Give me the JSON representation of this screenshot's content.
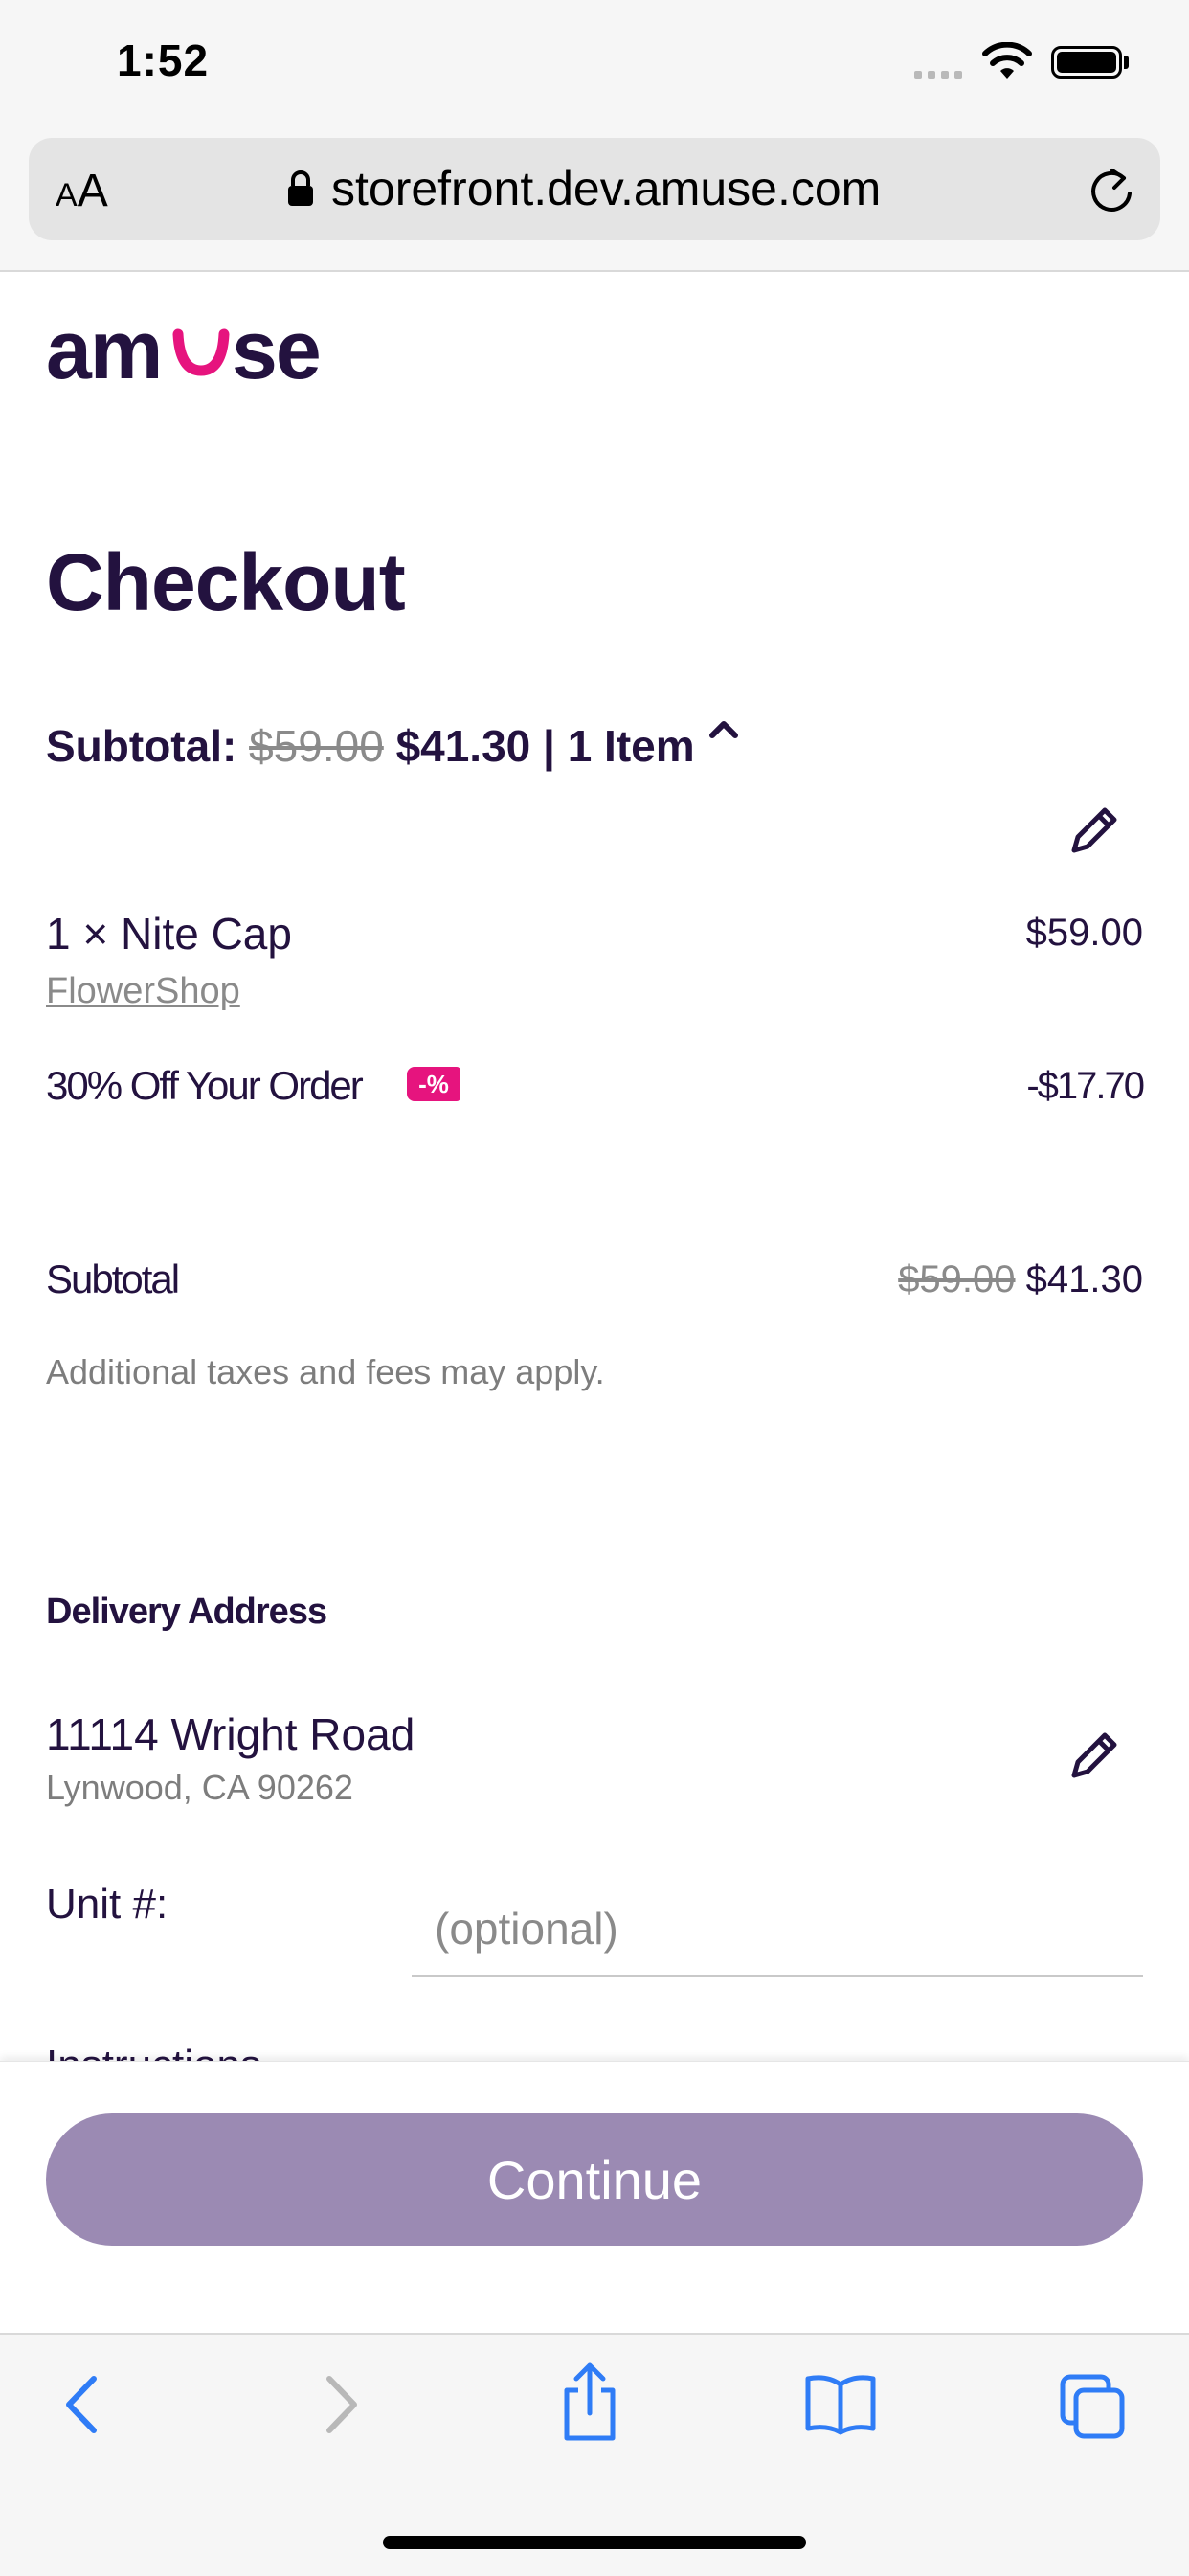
{
  "status_bar": {
    "time": "1:52"
  },
  "browser": {
    "text_size_label": "AA",
    "url": "storefront.dev.amuse.com"
  },
  "brand": {
    "logo_text": "amuse",
    "accent_color": "#e6147e",
    "primary_color": "#23123f"
  },
  "page": {
    "title": "Checkout"
  },
  "summary": {
    "label": "Subtotal:",
    "original_price": "$59.00",
    "price": "$41.30",
    "item_count": "| 1 Item"
  },
  "line_items": [
    {
      "quantity_name": "1 × Nite Cap",
      "shop": "FlowerShop",
      "price": "$59.00"
    }
  ],
  "discount": {
    "label": "30% Off Your Order",
    "badge": "-%",
    "amount": "-$17.70"
  },
  "subtotal": {
    "label": "Subtotal",
    "original_price": "$59.00",
    "price": "$41.30",
    "note": "Additional taxes and fees may apply."
  },
  "delivery": {
    "section_title": "Delivery Address",
    "address_line1": "11114 Wright Road",
    "address_line2": "Lynwood, CA 90262",
    "unit_label": "Unit #:",
    "unit_value": "",
    "unit_placeholder": "(optional)",
    "next_label_partial": "Instructions"
  },
  "actions": {
    "continue_label": "Continue",
    "continue_color": "#9b8ab3"
  },
  "browser_toolbar": {
    "icons": [
      "back-icon",
      "forward-icon",
      "share-icon",
      "bookmarks-icon",
      "tabs-icon"
    ],
    "icon_color": "#2f7cf6"
  }
}
